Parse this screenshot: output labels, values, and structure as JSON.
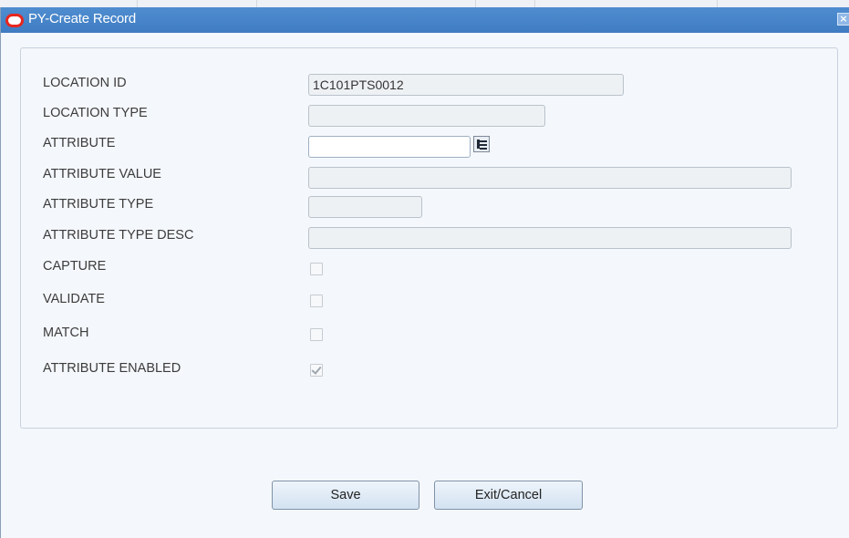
{
  "window": {
    "title": "PY-Create Record",
    "close_glyph": "×"
  },
  "form": {
    "fields": [
      {
        "label": "LOCATION ID",
        "value": "1C101PTS0012"
      },
      {
        "label": "LOCATION TYPE",
        "value": ""
      },
      {
        "label": "ATTRIBUTE",
        "value": ""
      },
      {
        "label": "ATTRIBUTE VALUE",
        "value": ""
      },
      {
        "label": "ATTRIBUTE TYPE",
        "value": ""
      },
      {
        "label": "ATTRIBUTE TYPE DESC",
        "value": ""
      }
    ],
    "checkboxes": [
      {
        "label": "CAPTURE",
        "checked": false
      },
      {
        "label": "VALIDATE",
        "checked": false
      },
      {
        "label": "MATCH",
        "checked": false
      },
      {
        "label": "ATTRIBUTE ENABLED",
        "checked": true
      }
    ]
  },
  "buttons": {
    "save": "Save",
    "exit": "Exit/Cancel"
  },
  "icons": {
    "logo": "oracle-logo-icon",
    "lov": "list-of-values-icon",
    "close": "close-icon"
  },
  "colors": {
    "titlebar": "#3f7cc2",
    "logo": "#e8271e"
  }
}
